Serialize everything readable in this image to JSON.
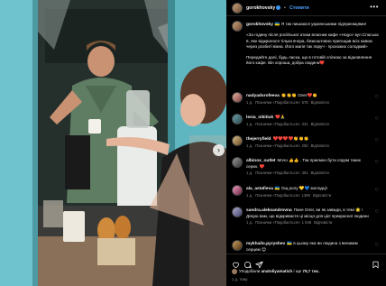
{
  "header": {
    "username": "gorokhovsky",
    "separator": "•",
    "follow_label": "Стежити",
    "more_label": "•••"
  },
  "caption": {
    "username": "gorokhovsky",
    "paragraphs": [
      "🇺🇦 Я так пишаюся українськими підприємцями!",
      "«За годину після російської атаки власник кафе «Hogo» вул.Спаська 6, яке відкрилося тільки вчора, безкоштовно пригощав всіх кавою через розбиті вікна. Його магія так поруч - прохожих солодкий»",
      "Передайте далі, будь ласка, що в готовій спілкою за відновлення його кафе. Він хороша, добра людина❤️"
    ]
  },
  "comments": [
    {
      "username": "nadyadorofeeva",
      "text": "👏👏👏 Олег❤️👏",
      "time": "1 д.",
      "likes": "Позначки «Подобається»: 578",
      "reply": "Відповісти"
    },
    {
      "username": "lesia_nikitiuk",
      "text": "❤️🙏",
      "time": "1 д.",
      "likes": "Позначки «Подобається»: 331",
      "reply": "Відповісти"
    },
    {
      "username": "thejerryfield",
      "text": "❤️❤️❤️❤️👏👏👏",
      "time": "1 д.",
      "likes": "Позначки «Подобається»: 250",
      "reply": "Відповісти"
    },
    {
      "username": "albinox_outlet",
      "text": "Мочо 👍👍 . Так приємно бути сядом таких серих. ❤️",
      "time": "1 д.",
      "likes": "Позначки «Подобається»: 361",
      "reply": "Відповісти"
    },
    {
      "username": "ala_astafieva",
      "text": "🇺🇦 Ощ ролу 💛💙 молодці!",
      "time": "1 д.",
      "likes": "Позначки «Подобається»: 1390",
      "reply": "Відповісти"
    },
    {
      "username": "sandra.aleksandrovna",
      "text": "Пане Олег, ви як завжди, в темі 🌟 ! Дякую вам, що відкриваєте ці місця для цієї прекрасної людини",
      "time": "1 д.",
      "likes": "Позначки «Подобається»: 1 546",
      "reply": "Відповісти"
    },
    {
      "username": "mykhailo.pyryshev",
      "text": "🇺🇦 в цьому яка ви людина з великим серцем 😊",
      "time": "1 д.",
      "likes": "",
      "reply": ""
    }
  ],
  "actions": {
    "liked_prefix": "Уподобали",
    "liked_user": "anatoliyamatich",
    "liked_mid": "і ще",
    "liked_count": "79,7 тис.",
    "date": "1 д. тому"
  },
  "icons": {
    "like": "heart-icon",
    "comment": "comment-icon",
    "share": "share-icon",
    "save": "bookmark-icon",
    "next": "chevron-right-icon"
  },
  "colors": {
    "background": "#000000",
    "accent_link": "#4aa3ff",
    "verified": "#3897f0",
    "muted": "#8e8e8e"
  }
}
